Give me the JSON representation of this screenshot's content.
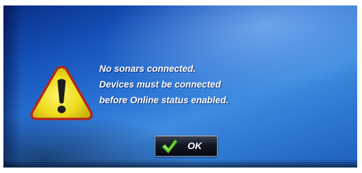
{
  "dialog": {
    "message_lines": [
      "No sonars connected.",
      "Devices must be connected",
      "before Online status enabled."
    ],
    "icon": "warning-icon"
  },
  "ok_button": {
    "label": "OK",
    "icon": "check-icon"
  },
  "colors": {
    "background_blue": "#1f5fc0",
    "text": "#ffffff",
    "warning_yellow": "#f2e21c",
    "warning_border": "#b3261e",
    "check_green": "#6fd13a"
  }
}
